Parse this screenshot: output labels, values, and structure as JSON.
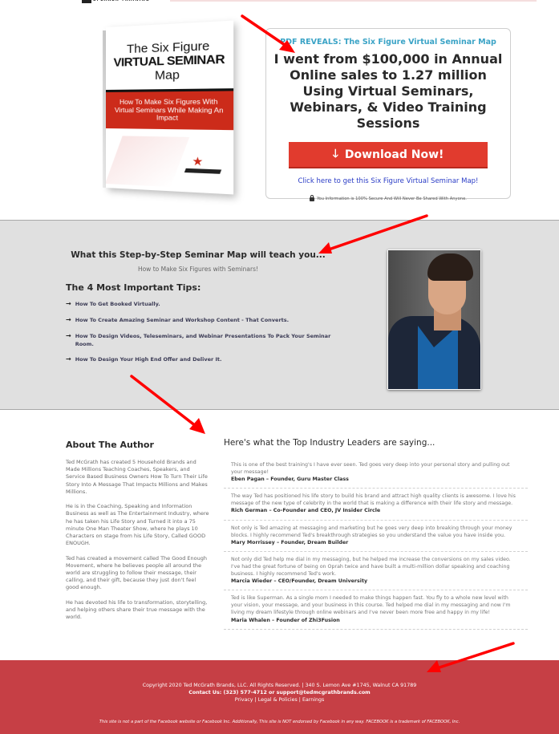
{
  "header": {
    "logo_text": "SPEAKER TRAINING"
  },
  "hero": {
    "book": {
      "title_line1": "The Six Figure",
      "title_line2": "VIRTUAL SEMINAR",
      "title_line3": "Map",
      "subtitle": "How To Make Six Figures With Virtual Seminars While Making An Impact"
    },
    "optin": {
      "kicker": "PDF REVEALS: The Six Figure Virtual Seminar Map",
      "headline": "I went from $100,000 in Annual Online sales to 1.27 million Using Virtual Seminars, Webinars, & Video Training Sessions",
      "button_icon": "arrow-down-icon",
      "button_label": "Download Now!",
      "link_text": "Click here to get this Six Figure Virtual Seminar Map!",
      "secure_icon": "lock-icon",
      "secure_text": "You Information is 100% Secure And Will Never Be Shared With Anyone."
    },
    "colors": {
      "kicker": "#3aa3c6",
      "button": "#e13b2e",
      "link": "#2a3cc6"
    }
  },
  "teach": {
    "title": "What this Step-by-Step Seminar Map will teach you...",
    "subtitle": "How to Make Six Figures with Seminars!",
    "tips_title": "The 4 Most Important Tips:",
    "tips": [
      "How To Get Booked Virtually.",
      "How To Create Amazing Seminar and Workshop Content - That Converts.",
      "How To Design Videos, Teleseminars, and Webinar Presentations To Pack Your Seminar Room.",
      "How To Design Your High End Offer and Deliver It."
    ]
  },
  "author": {
    "title": "About The Author",
    "paragraphs": [
      "Ted McGrath has created 5 Household Brands and Made Millions Teaching Coaches, Speakers, and Service Based Business Owners How To Turn Their Life Story Into A Message That Impacts Millions and Makes Millions.",
      "He is in the Coaching, Speaking and Information Business as well as The Entertainment Industry, where he has taken his Life Story and Turned it into a 75 minute One Man Theater Show, where he plays 10 Characters on stage from his Life Story, Called GOOD ENOUGH.",
      "Ted has created a movement called The Good Enough Movement, where he believes people all around the world are struggling to follow their message, their calling, and their gift, because they just don't feel good enough.",
      "He has devoted his life to transformation, storytelling, and helping others share their true message with the world."
    ]
  },
  "testimonials": {
    "title": "Here's what the Top Industry Leaders are saying...",
    "items": [
      {
        "quote": "This is one of the best training's I have ever seen. Ted goes very deep into your personal story and pulling out your message!",
        "author": "Eben Pagan – Founder, Guru Master Class"
      },
      {
        "quote": "The way Ted has positioned his life story to build his brand and attract high quality clients is awesome. I love his message of the new type of celebrity in the world that is making a difference with their life story and message.",
        "author": "Rich German – Co-Founder and CEO, JV Insider Circle"
      },
      {
        "quote": "Not only is Ted amazing at messaging and marketing but he goes very deep into breaking through your money blocks. I highly recommend Ted's breakthrough strategies so you understand the value you have inside you.",
        "author": "Mary Morrissey – Founder, Dream Builder"
      },
      {
        "quote": "Not only did Ted help me dial in my messaging, but he helped me increase the conversions on my sales video. I've had the great fortune of being on Oprah twice and have built a multi-million dollar speaking and coaching business. I highly recommend Ted's work.",
        "author": "Marcia Wieder – CEO/Founder, Dream University"
      },
      {
        "quote": "Ted is like Superman. As a single mom I needed to make things happen fast. You fly to a whole new level with your vision, your message, and your business in this course. Ted helped me dial in my messaging and now I'm living my dream lifestyle through online webinars and I've never been more free and happy in my life!",
        "author": "Maria Whalen – Founder of Zhi3Fusion"
      }
    ]
  },
  "footer": {
    "copyright": "Copyright 2020 Ted McGrath Brands, LLC. All Rights Reserved. | 340 S. Lemon Ave #1745, Walnut CA 91789",
    "contact": "Contact Us: (323) 577-4712 or support@tedmcgrathbrands.com",
    "links": [
      {
        "label": "Privacy"
      },
      {
        "label": "Legal & Policies"
      },
      {
        "label": "Earnings"
      }
    ],
    "separator": "|",
    "disclaimer": "This site is not a part of the Facebook website or Facebook Inc. Additionally, This site is NOT endorsed by Facebook in any way. FACEBOOK is a trademark of FACEBOOK, Inc.",
    "background": "#c63f45"
  },
  "annotations": {
    "arrow_color": "#ff0000",
    "count": 4
  }
}
